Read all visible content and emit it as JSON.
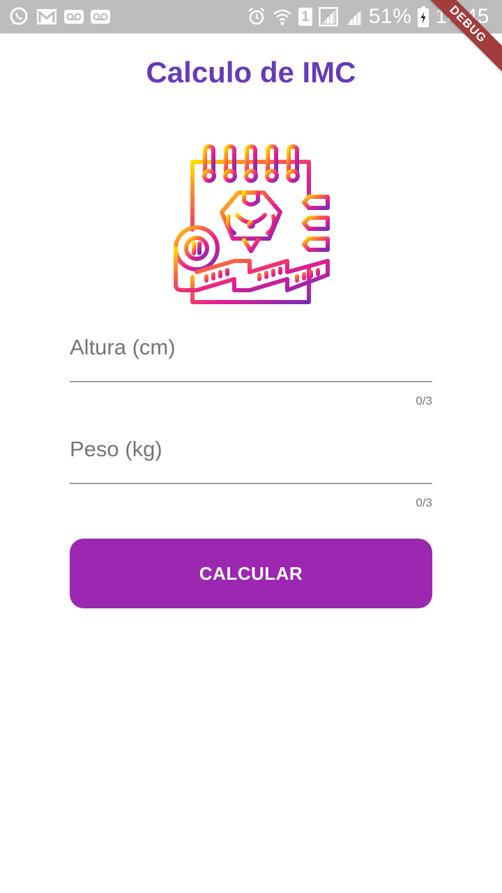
{
  "status_bar": {
    "battery_percent": "51%",
    "time": "14:45",
    "sim_slot": "1",
    "left_icons": [
      "whatsapp-icon",
      "gmail-icon",
      "voicemail-icon",
      "voicemail-icon"
    ],
    "right_icons": [
      "alarm-icon",
      "wifi-icon",
      "sim-1-icon",
      "signal-icon",
      "signal-icon",
      "battery-charging-icon"
    ]
  },
  "debug_banner": "DEBUG",
  "app": {
    "title": "Calculo de IMC",
    "logo_icon": "notebook-measuring-tape-icon",
    "title_color": "#673ab7",
    "accent_color": "#9c27b0"
  },
  "form": {
    "height": {
      "placeholder": "Altura (cm)",
      "value": "",
      "counter": "0/3"
    },
    "weight": {
      "placeholder": "Peso (kg)",
      "value": "",
      "counter": "0/3"
    },
    "submit_label": "CALCULAR"
  }
}
